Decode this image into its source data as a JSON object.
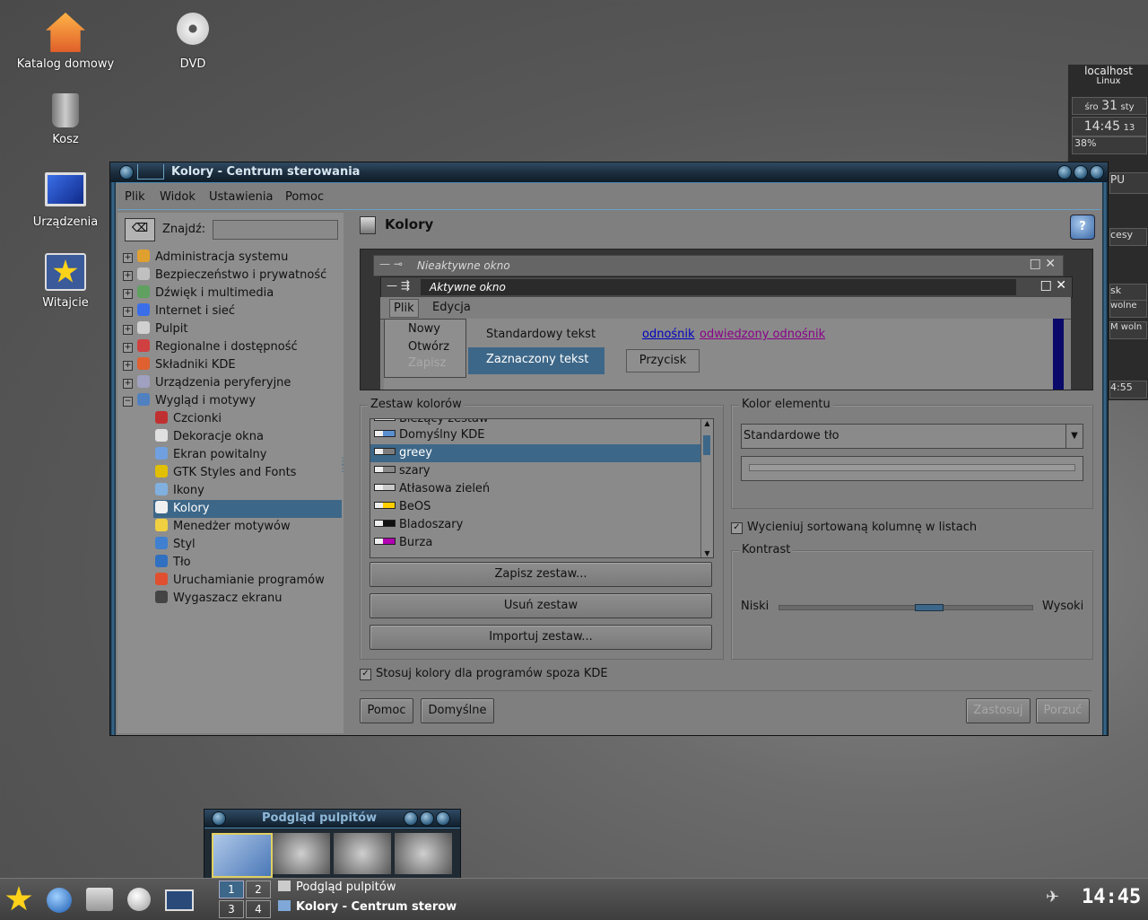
{
  "desktop": {
    "icons": [
      {
        "label": "Katalog domowy"
      },
      {
        "label": "DVD"
      },
      {
        "label": "Kosz"
      },
      {
        "label": "Urządzenia"
      },
      {
        "label": "Witajcie"
      }
    ]
  },
  "window": {
    "title": "Kolory - Centrum sterowania",
    "menu": [
      "Plik",
      "Widok",
      "Ustawienia",
      "Pomoc"
    ],
    "find_label": "Znajdź:",
    "find_value": "",
    "tree": [
      {
        "label": "Administracja systemu",
        "expander": "+"
      },
      {
        "label": "Bezpieczeństwo i prywatność",
        "expander": "+"
      },
      {
        "label": "Dźwięk i multimedia",
        "expander": "+"
      },
      {
        "label": "Internet i sieć",
        "expander": "+"
      },
      {
        "label": "Pulpit",
        "expander": "+"
      },
      {
        "label": "Regionalne i dostępność",
        "expander": "+"
      },
      {
        "label": "Składniki KDE",
        "expander": "+"
      },
      {
        "label": "Urządzenia peryferyjne",
        "expander": "+"
      },
      {
        "label": "Wygląd i motywy",
        "expander": "−"
      }
    ],
    "subtree": [
      {
        "label": "Czcionki"
      },
      {
        "label": "Dekoracje okna"
      },
      {
        "label": "Ekran powitalny"
      },
      {
        "label": "GTK Styles and Fonts"
      },
      {
        "label": "Ikony"
      },
      {
        "label": "Kolory",
        "selected": true
      },
      {
        "label": "Menedżer motywów"
      },
      {
        "label": "Styl"
      },
      {
        "label": "Tło"
      },
      {
        "label": "Uruchamianie programów"
      },
      {
        "label": "Wygaszacz ekranu"
      }
    ],
    "module_title": "Kolory",
    "help_icon_label": "?"
  },
  "preview": {
    "inactive_title": "Nieaktywne okno",
    "active_title": "Aktywne okno",
    "menu": [
      "Plik",
      "Edycja"
    ],
    "popup": [
      "Nowy",
      "Otwórz",
      "Zapisz"
    ],
    "standard_text": "Standardowy tekst",
    "selected_text": "Zaznaczony tekst",
    "link": "odnośnik",
    "visited_link": "odwiedzony odnośnik",
    "button": "Przycisk"
  },
  "schemes": {
    "group_label": "Zestaw kolorów",
    "partial_top": "Bieżący zestaw",
    "items": [
      {
        "label": "Domyślny KDE",
        "swatch": "#5a8fcf"
      },
      {
        "label": "greey",
        "swatch": "#7d7d7d",
        "selected": true
      },
      {
        "label": "szary",
        "swatch": "#888888"
      },
      {
        "label": "Atłasowa zieleń",
        "swatch": "#c8c8c8"
      },
      {
        "label": "BeOS",
        "swatch": "#ffcf00"
      },
      {
        "label": "Bladoszary",
        "swatch": "#111111"
      },
      {
        "label": "Burza",
        "swatch": "#b000b0"
      }
    ],
    "save_button": "Zapisz zestaw...",
    "remove_button": "Usuń zestaw",
    "import_button": "Importuj zestaw..."
  },
  "element": {
    "group_label": "Kolor elementu",
    "selected": "Standardowe tło",
    "shade_label": "Wycieniuj sortowaną kolumnę w listach",
    "shade_checked": true,
    "contrast_label": "Kontrast",
    "low": "Niski",
    "high": "Wysoki",
    "contrast_fraction": 0.6
  },
  "apply_nonkde_label": "Stosuj kolory dla programów spoza KDE",
  "apply_nonkde_checked": true,
  "bottom_buttons": {
    "help": "Pomoc",
    "defaults": "Domyślne",
    "apply": "Zastosuj",
    "reset": "Porzuć"
  },
  "pager": {
    "title": "Podgląd pulpitów",
    "desktops": [
      "1",
      "2",
      "3",
      "4"
    ]
  },
  "taskbar": {
    "tasks": [
      "Podgląd pulpitów",
      "Kolory - Centrum sterow"
    ],
    "clock": "14:45"
  },
  "monitor": {
    "host": "localhost",
    "os": "Linux",
    "day": "śro",
    "date": "31",
    "month": "sty",
    "time": "14:45",
    "seconds": "13",
    "cpu_percent": "38%",
    "partials": [
      "PU",
      "cesy",
      "sk",
      "wolne",
      "M woln",
      "4:55"
    ]
  },
  "colors": {
    "accent": "#3d6788",
    "link": "#0000c0",
    "visited": "#8a008a",
    "titlebar": "#1b2c3c"
  }
}
